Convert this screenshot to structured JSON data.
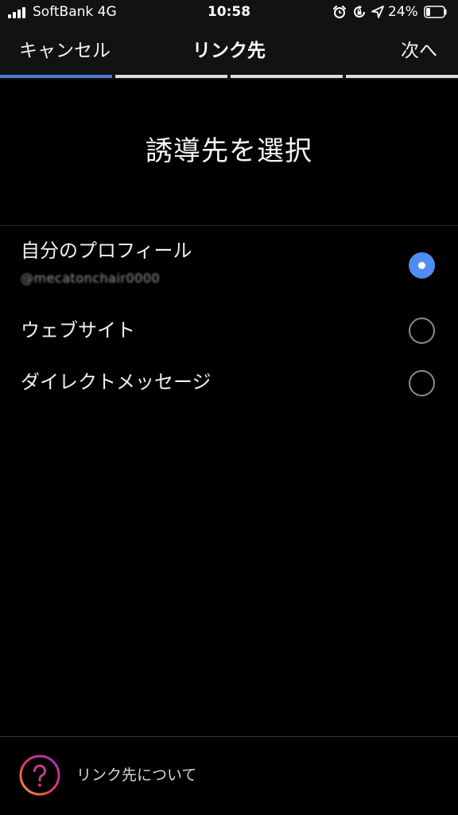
{
  "status_bar": {
    "carrier": "SoftBank 4G",
    "time": "10:58",
    "battery_percent": "24%",
    "battery_level": 0.24,
    "icons": [
      "signal-bars-icon",
      "alarm-icon",
      "rotation-lock-icon",
      "location-arrow-icon",
      "battery-icon"
    ]
  },
  "nav": {
    "cancel_label": "キャンセル",
    "title": "リンク先",
    "next_label": "次へ"
  },
  "progress": {
    "total_steps": 4,
    "current_step": 1,
    "active_color": "#4a7fd0"
  },
  "heading": "誘導先を選択",
  "options": [
    {
      "label": "自分のプロフィール",
      "sub": "@mecatonchair0000",
      "selected": true
    },
    {
      "label": "ウェブサイト",
      "selected": false
    },
    {
      "label": "ダイレクトメッセージ",
      "selected": false
    }
  ],
  "colors": {
    "radio_selected": "#4f8ef0",
    "background": "#000000",
    "header_background": "#121212"
  },
  "footer": {
    "help_icon": "question-circle-icon",
    "help_text": "リンク先について"
  }
}
